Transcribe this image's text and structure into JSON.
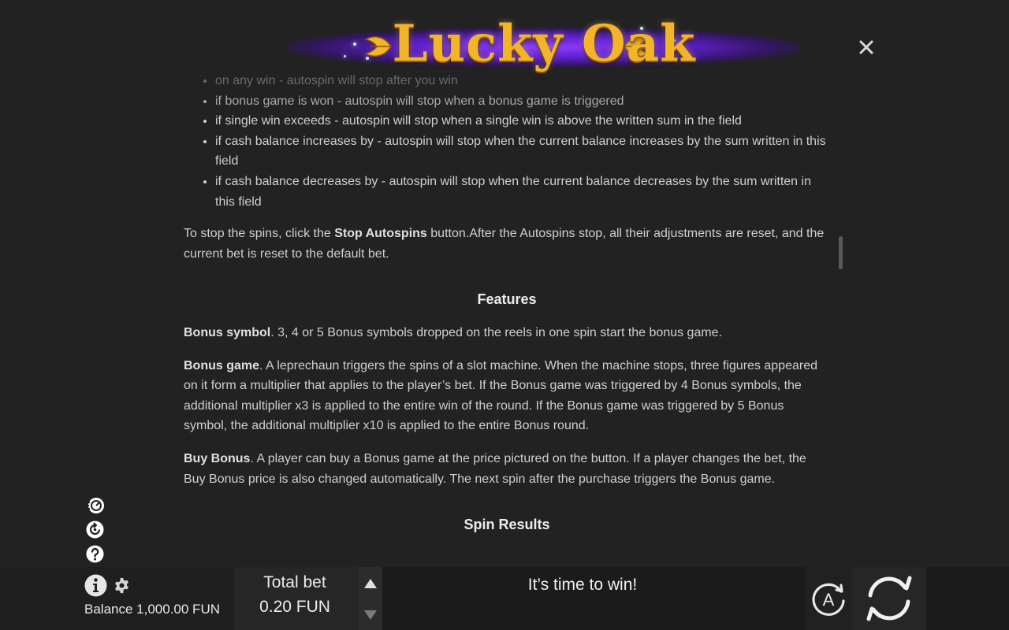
{
  "logo": {
    "text": "Lucky Oak"
  },
  "autospin_options": [
    {
      "text": "on any win - autospin will stop after you win"
    },
    {
      "text": "if bonus game is won - autospin will stop when a bonus game is triggered"
    },
    {
      "text": "if single win exceeds - autospin will stop when a single win is above the written sum in the field"
    },
    {
      "text": "if cash balance increases by - autospin will stop when the current balance increases by the sum written in this field"
    },
    {
      "text": "if cash balance decreases by - autospin will stop when the current balance decreases by the sum written in this field"
    }
  ],
  "stop_paragraph": {
    "before": "To stop the spins, click the ",
    "bold": "Stop Autospins",
    "after": " button.After the Autospins stop, all their adjustments are reset, and the current bet is reset to the default bet."
  },
  "features": {
    "heading": "Features",
    "items": [
      {
        "title": "Bonus symbol",
        "text": ". 3, 4 or 5 Bonus symbols dropped on the reels in one spin start the bonus game."
      },
      {
        "title": "Bonus game",
        "text": ". A leprechaun triggers the spins of a slot machine. When the machine stops, three figures appeared on it form a multiplier that applies to the player’s bet. If the Bonus game was triggered by 4 Bonus symbols, the additional multiplier x3 is applied to the entire win of the round. If the Bonus game was triggered by 5 Bonus symbol, the additional multiplier x10 is applied to the entire Bonus round."
      },
      {
        "title": "Buy Bonus",
        "text": ". A player can buy a Bonus game at the price pictured on the button. If a player changes the bet, the Buy Bonus price is also changed automatically. The next spin after the purchase triggers the Bonus game."
      }
    ]
  },
  "spin_results": {
    "heading": "Spin Results"
  },
  "bottom_bar": {
    "balance": "Balance 1,000.00 FUN",
    "total_bet_label": "Total bet",
    "total_bet_value": "0.20 FUN",
    "message": "It’s time to win!",
    "autoplay_letter": "A"
  },
  "icons": {
    "close": "close-icon",
    "turbo": "turbo-icon",
    "history": "history-icon",
    "help": "help-icon",
    "info": "info-icon",
    "settings": "gear-icon",
    "bet_up": "bet-up-arrow-icon",
    "bet_down": "bet-down-arrow-icon",
    "autoplay": "autoplay-icon",
    "spin": "spin-icon"
  },
  "colors": {
    "background": "#222222",
    "logo_gold": "#f2b52a",
    "logo_glow": "#8e3bff"
  }
}
